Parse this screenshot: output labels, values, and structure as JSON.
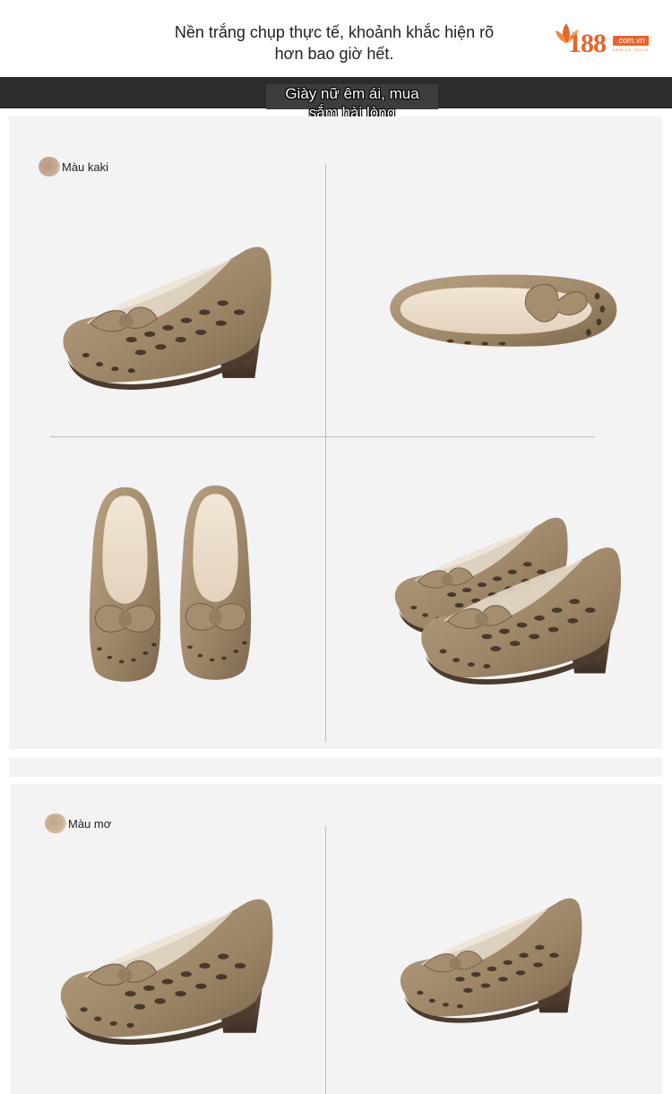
{
  "header": {
    "line1": "Nền trắng chụp thực tế, khoảnh khắc hiện rõ",
    "line2": "hơn bao giờ hết."
  },
  "logo": {
    "number": "188",
    "domain": ".com.vn",
    "tagline": "XEM LÀ THÍCH"
  },
  "banner": {
    "line1": "Giày nữ êm ái, mua",
    "line2": "sắm hài lòng"
  },
  "colors": {
    "banner_bg": "#2c2c2c",
    "panel_bg": "#f3f3f3",
    "shoe_leather": "#a08a6c",
    "logo_orange": "#e8632a"
  },
  "sections": [
    {
      "swatch_label": "Màu kaki",
      "images": [
        "shoe-side-view",
        "shoe-top-view",
        "shoe-pair-top-view",
        "shoe-pair-angle-view"
      ]
    },
    {
      "swatch_label": "Màu mơ",
      "images": [
        "shoe-side-view",
        "shoe-side-view"
      ]
    }
  ]
}
